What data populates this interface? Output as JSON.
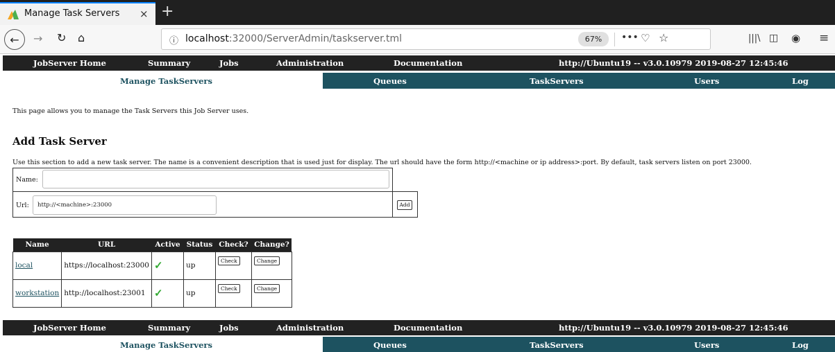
{
  "browser": {
    "tab_title": "Manage Task Servers",
    "tab_close": "×",
    "new_tab": "+",
    "url_host": "localhost",
    "url_rest": ":32000/ServerAdmin/taskserver.tml",
    "zoom": "67%"
  },
  "menu": {
    "top": [
      "JobServer Home",
      "Summary",
      "Jobs",
      "Administration",
      "Documentation",
      "http://Ubuntu19 -- v3.0.10979  2019-08-27 12:45:46"
    ],
    "sub_current": "Manage TaskServers",
    "sub": [
      "Queues",
      "TaskServers",
      "Users",
      "Log"
    ]
  },
  "page": {
    "intro": "This page allows you to manage the Task Servers this Job Server uses.",
    "heading": "Add Task Server",
    "help": "Use this section to add a new task server. The name is a convenient description that is used just for display. The url should have the form http://<machine or ip address>:port. By default, task servers listen on port 23000.",
    "name_label": "Name:",
    "url_label": "Url:",
    "url_placeholder": "http://<machine>:23000",
    "add_label": "Add"
  },
  "table": {
    "headers": [
      "Name",
      "URL",
      "Active",
      "Status",
      "Check?",
      "Change?"
    ],
    "rows": [
      {
        "name": "local",
        "url": "https://localhost:23000",
        "active": "✓",
        "status": "up",
        "check": "Check",
        "change": "Change"
      },
      {
        "name": "workstation",
        "url": "http://localhost:23001",
        "active": "✓",
        "status": "up",
        "check": "Check",
        "change": "Change"
      }
    ]
  }
}
